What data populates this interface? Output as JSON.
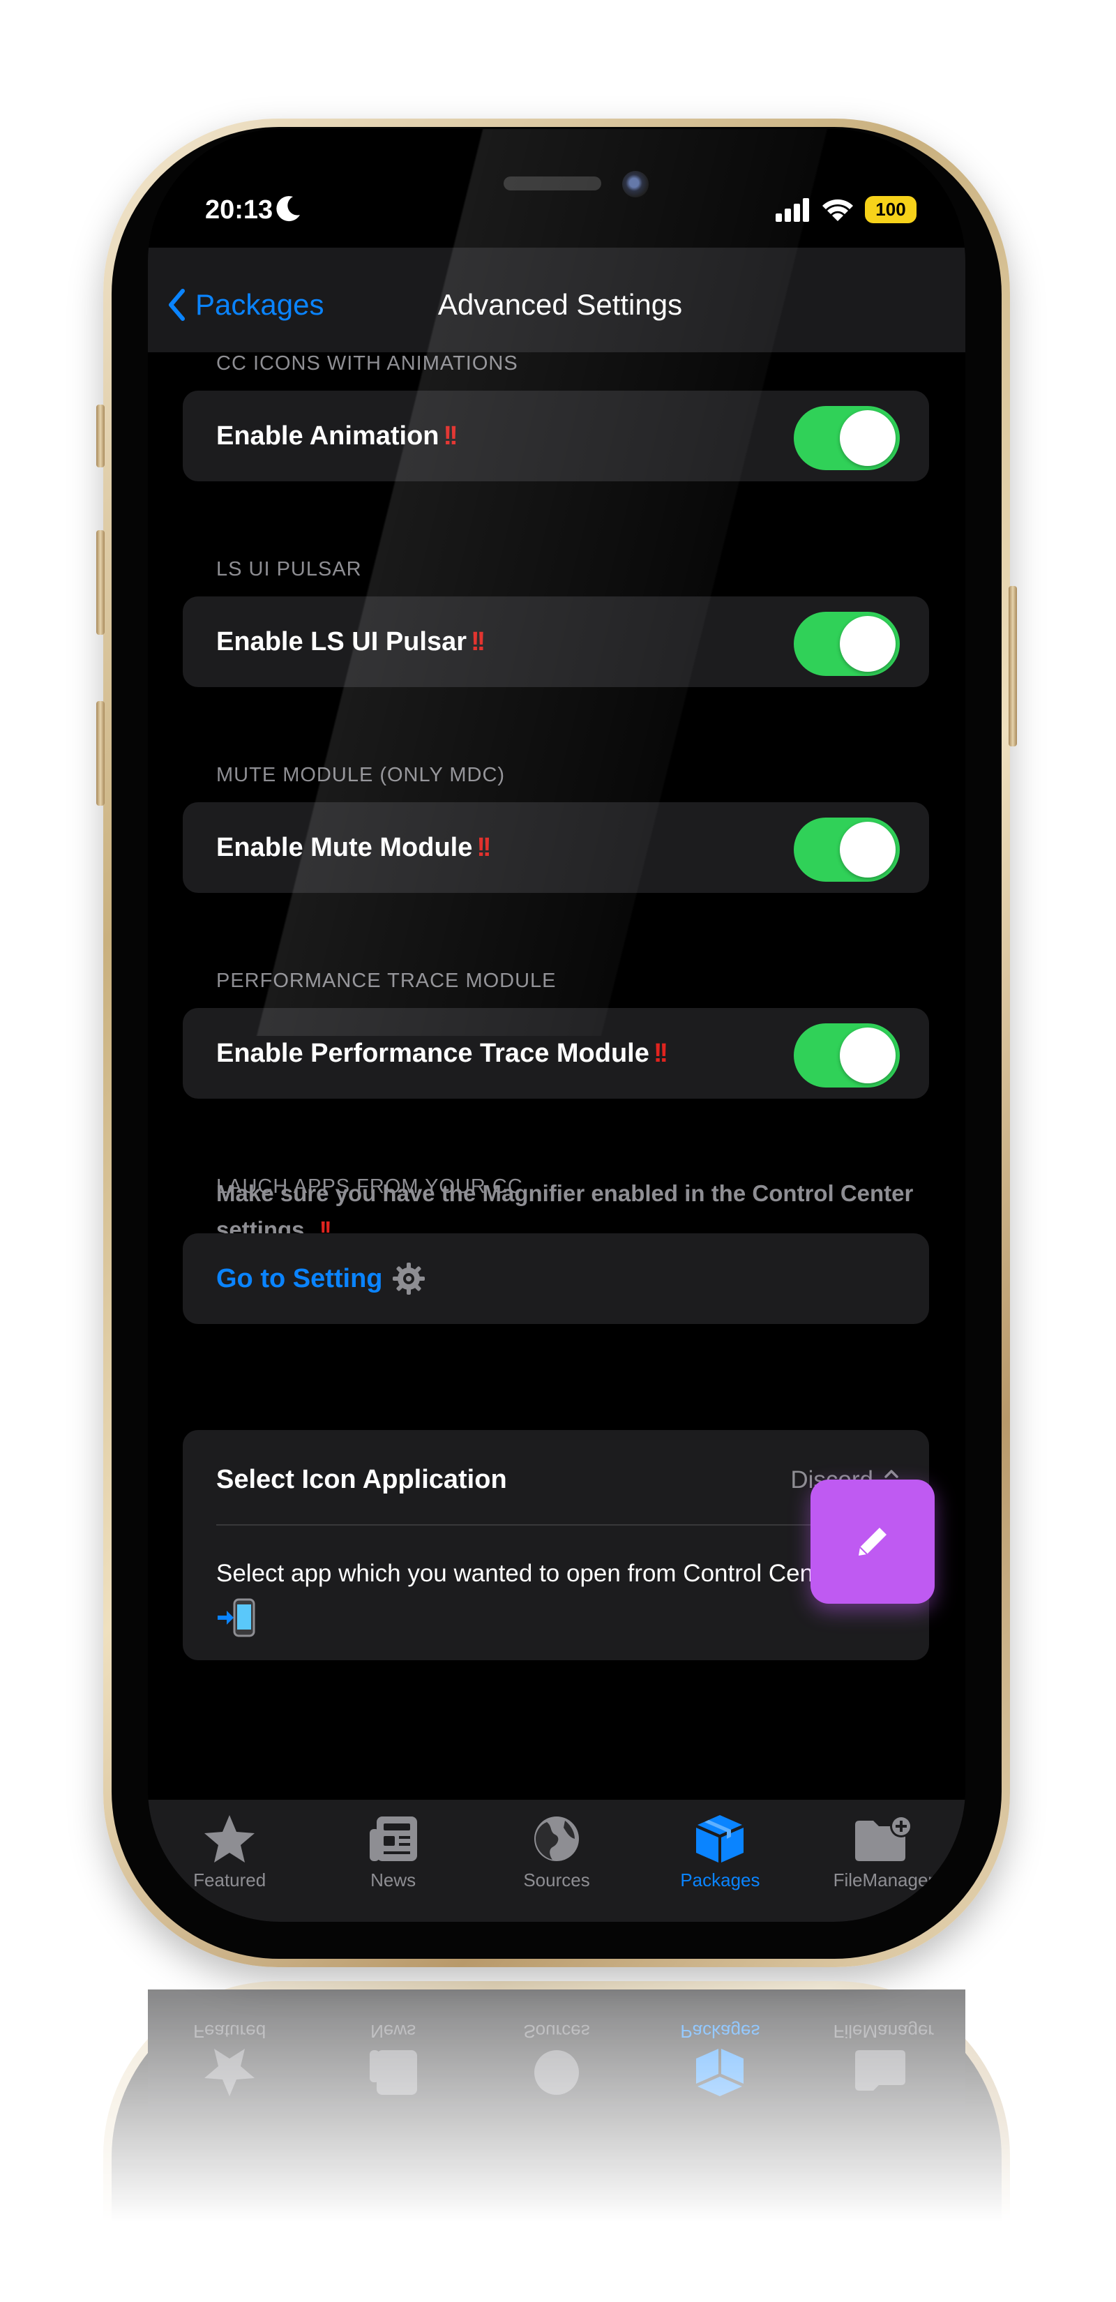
{
  "status_bar": {
    "time": "20:13",
    "battery": "100"
  },
  "nav": {
    "back_label": "Packages",
    "title": "Advanced Settings"
  },
  "sections": [
    {
      "header": "CC ICONS WITH ANIMATIONS",
      "label": "Enable Animation",
      "enabled": true
    },
    {
      "header": "LS UI PULSAR",
      "label": "Enable LS UI Pulsar",
      "enabled": true
    },
    {
      "header": "MUTE MODULE (ONLY MDC)",
      "label": "Enable Mute Module",
      "enabled": true
    },
    {
      "header": "PERFORMANCE TRACE MODULE",
      "label": "Enable Performance Trace Module",
      "enabled": true
    }
  ],
  "launch_section": {
    "header": "LAUCH APPS FROM YOUR CC",
    "note": "Make sure you have the Magnifier enabled in the Control Center settings",
    "link_label": "Go to Setting"
  },
  "select": {
    "title": "Select Icon Application",
    "value": "Discord",
    "description": "Select app which you wanted to open from Control Center"
  },
  "tabs": [
    {
      "label": "Featured",
      "icon": "star-icon"
    },
    {
      "label": "News",
      "icon": "newspaper-icon"
    },
    {
      "label": "Sources",
      "icon": "globe-icon"
    },
    {
      "label": "Packages",
      "icon": "box-icon",
      "active": true
    },
    {
      "label": "FileManager",
      "icon": "folder-plus-icon"
    }
  ],
  "colors": {
    "accent": "#0a84ff",
    "toggle_on": "#30d158",
    "fab": "#bf5af2",
    "warning": "#e0241f"
  }
}
